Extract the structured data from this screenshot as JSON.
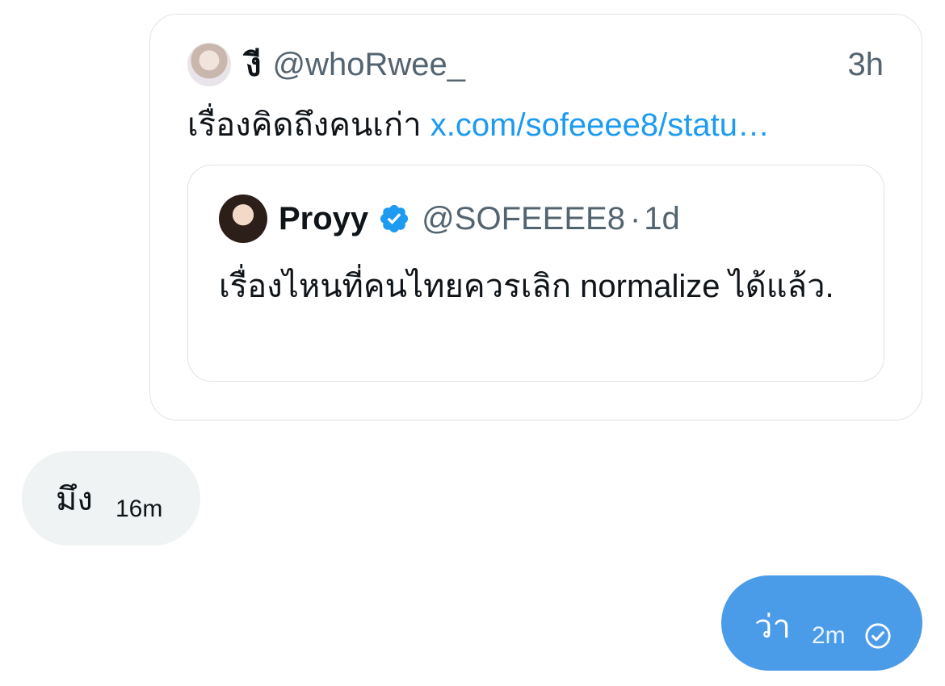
{
  "shared_tweet": {
    "author_name": "งี",
    "author_handle": "@whoRwee_",
    "time": "3h",
    "text": "เรื่องคิดถึงคนเก่า",
    "link": "x.com/sofeeee8/statu…"
  },
  "quoted_tweet": {
    "author_name": "Proyy",
    "author_handle": "@SOFEEEE8",
    "separator": "·",
    "time": "1d",
    "text": "เรื่องไหนที่คนไทยควรเลิก normalize ได้แล้ว."
  },
  "messages": [
    {
      "direction": "received",
      "text": "มึง",
      "time": "16m"
    },
    {
      "direction": "sent",
      "text": "ว่า",
      "time": "2m",
      "status_icon": "read-check-icon"
    }
  ],
  "colors": {
    "link": "#1d9bf0",
    "verified": "#1d9bf0",
    "sent_bubble": "#4a9be8",
    "received_bubble": "#eff3f4",
    "secondary_text": "#536471"
  },
  "icons": {
    "verified": "verified-badge-icon",
    "read": "read-check-icon"
  }
}
